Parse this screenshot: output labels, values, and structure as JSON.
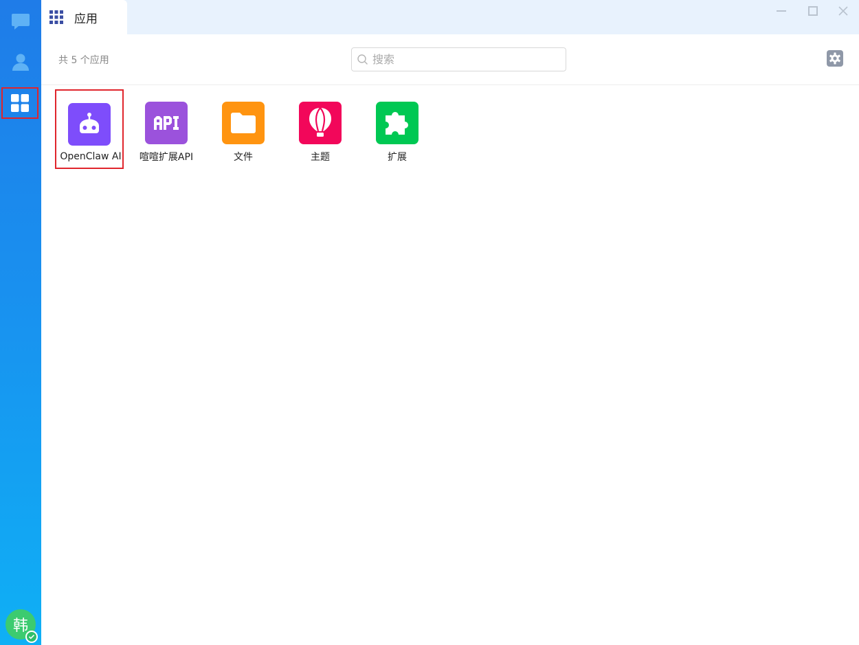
{
  "sidebar": {
    "items": [
      {
        "name": "chat"
      },
      {
        "name": "contacts"
      },
      {
        "name": "apps"
      }
    ],
    "avatar_text": "韩"
  },
  "tab": {
    "title": "应用"
  },
  "toolbar": {
    "count_text": "共 5 个应用",
    "search_placeholder": "搜索"
  },
  "apps": [
    {
      "label": "OpenClaw AI",
      "icon": "robot-icon",
      "color": "#7e4dfb"
    },
    {
      "label": "喧喧扩展API",
      "icon": "api-icon",
      "color": "#9b52dc"
    },
    {
      "label": "文件",
      "icon": "folder-icon",
      "color": "#ff9410"
    },
    {
      "label": "主题",
      "icon": "balloon-icon",
      "color": "#f2075a"
    },
    {
      "label": "扩展",
      "icon": "puzzle-icon",
      "color": "#00c853"
    }
  ],
  "colors": {
    "sidebar_top": "#1f7ce8",
    "sidebar_bottom": "#0fb0f5",
    "highlight": "#e0242b",
    "tabbar": "#e8f2fd"
  }
}
